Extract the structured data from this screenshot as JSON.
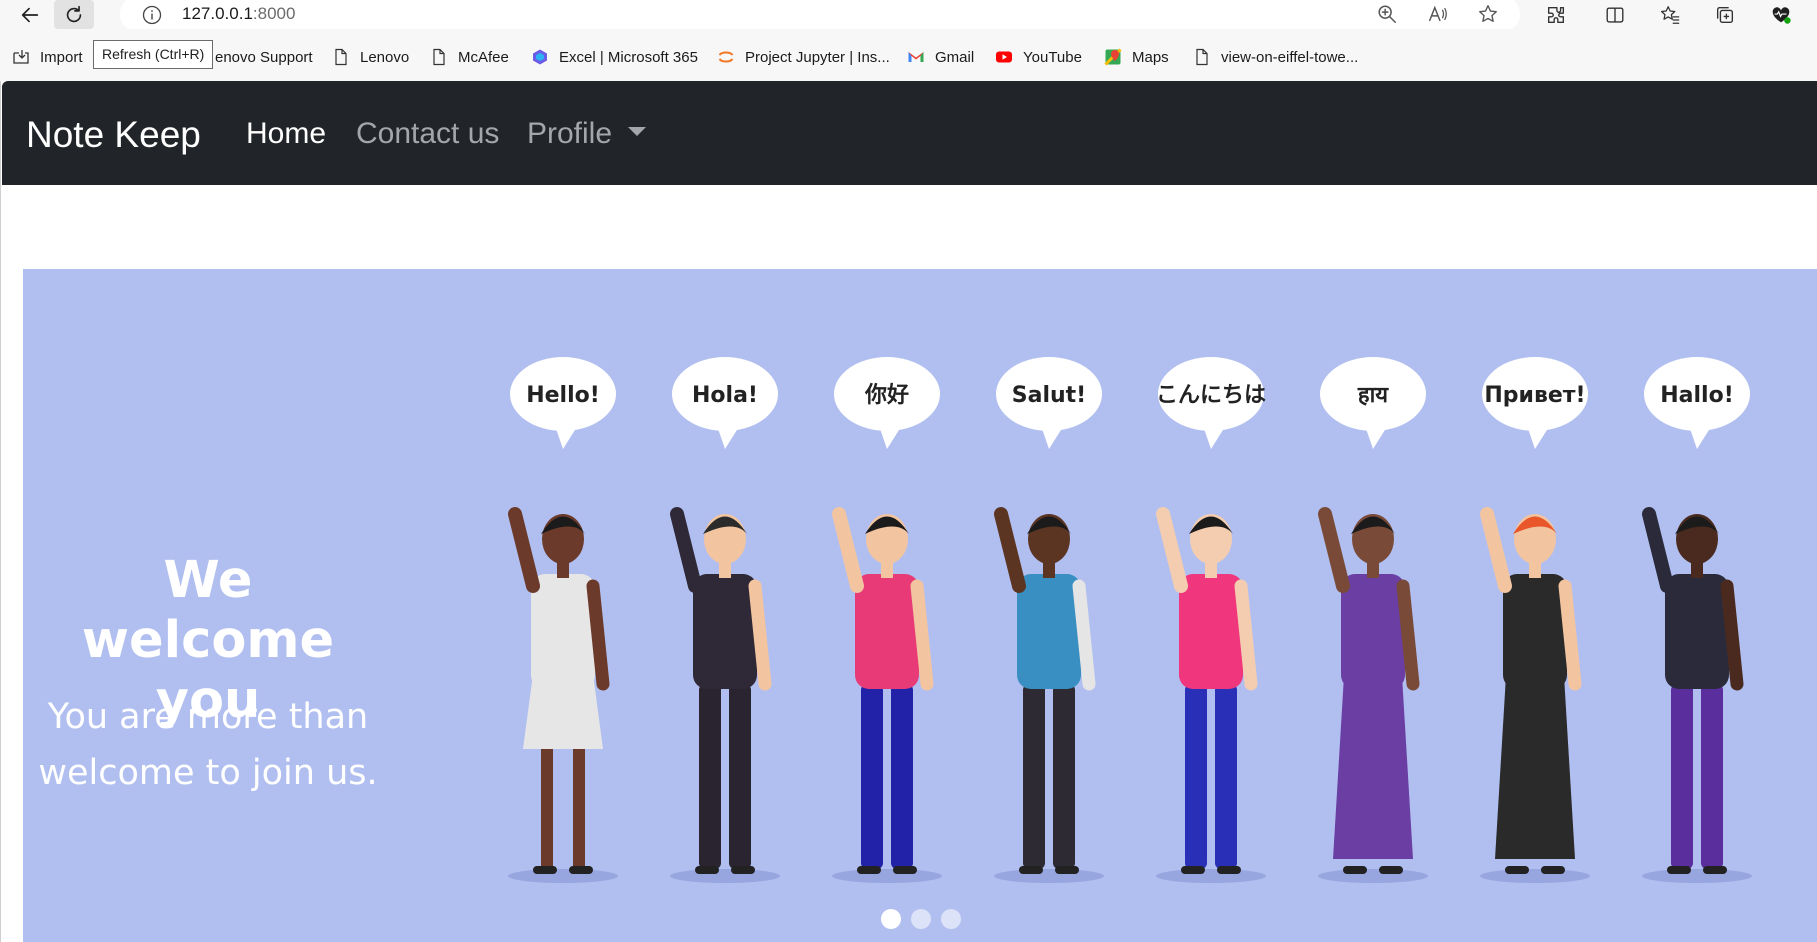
{
  "browser": {
    "tooltip": "Refresh (Ctrl+R)",
    "address": {
      "host": "127.0.0.1",
      "port": ":8000"
    },
    "toolbar_icons": [
      "back-arrow-icon",
      "refresh-icon",
      "info-icon",
      "zoom-icon",
      "read-aloud-icon",
      "favorite-star-icon",
      "extensions-icon",
      "split-screen-icon",
      "favorites-icon",
      "collections-icon",
      "browser-essentials-icon"
    ]
  },
  "bookmarks": [
    {
      "label": "Import",
      "icon": "import-icon"
    },
    {
      "label": "Lenovo Support",
      "visible_label": "enovo Support",
      "icon": "lenovo-icon"
    },
    {
      "label": "Lenovo",
      "icon": "page-icon"
    },
    {
      "label": "McAfee",
      "icon": "page-icon"
    },
    {
      "label": "Excel | Microsoft 365",
      "icon": "microsoft365-icon"
    },
    {
      "label": "Project Jupyter | Ins...",
      "icon": "jupyter-icon"
    },
    {
      "label": "Gmail",
      "icon": "gmail-icon"
    },
    {
      "label": "YouTube",
      "icon": "youtube-icon"
    },
    {
      "label": "Maps",
      "icon": "maps-icon"
    },
    {
      "label": "view-on-eiffel-towe...",
      "icon": "page-icon"
    }
  ],
  "navbar": {
    "brand": "Note Keep",
    "links": [
      {
        "label": "Home"
      },
      {
        "label": "Contact us"
      },
      {
        "label": "Profile"
      }
    ]
  },
  "carousel": {
    "title": "We welcome you",
    "text": "You are more than welcome to join us.",
    "greetings": [
      "Hello!",
      "Hola!",
      "你好",
      "Salut!",
      "こんにちは",
      "हाय",
      "Привет!",
      "Hallo!"
    ],
    "slide_count": 3,
    "active_slide": 1,
    "background": "#b1bff0"
  },
  "colors": {
    "navbar_bg": "#212529",
    "nav_active": "#ffffff",
    "nav_muted": "#a3a7ab"
  }
}
